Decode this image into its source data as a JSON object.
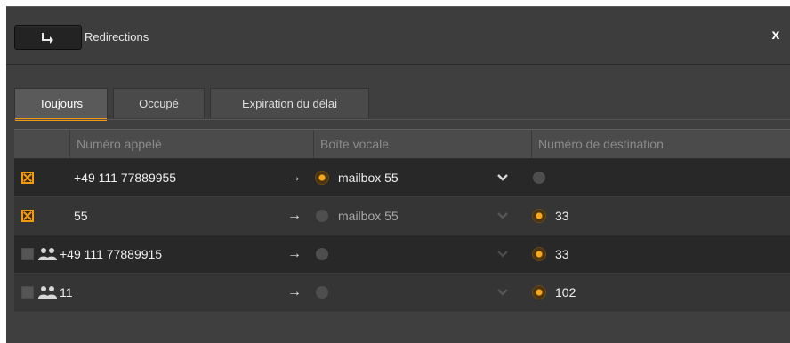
{
  "window": {
    "title": "Redirections",
    "close_label": "x"
  },
  "tabs": [
    {
      "label": "Toujours",
      "active": true
    },
    {
      "label": "Occupé",
      "active": false
    },
    {
      "label": "Expiration du délai",
      "active": false
    }
  ],
  "table": {
    "headers": [
      "Numéro appelé",
      "Boîte vocale",
      "Numéro de destination"
    ],
    "rows": [
      {
        "checked": true,
        "group": false,
        "number": "+49 111 77889955",
        "mailbox_selected": true,
        "mailbox": "mailbox 55",
        "dest_selected": false,
        "destination": ""
      },
      {
        "checked": true,
        "group": false,
        "number": "55",
        "mailbox_selected": false,
        "mailbox": "mailbox 55",
        "dest_selected": true,
        "destination": "33"
      },
      {
        "checked": false,
        "group": true,
        "number": "+49 111 77889915",
        "mailbox_selected": false,
        "mailbox": "",
        "dest_selected": true,
        "destination": "33"
      },
      {
        "checked": false,
        "group": true,
        "number": "11",
        "mailbox_selected": false,
        "mailbox": "",
        "dest_selected": true,
        "destination": "102"
      }
    ]
  },
  "icons": {
    "title_button": "redirect-arrow-icon",
    "row_arrow": "right-arrow-icon",
    "dropdown": "chevron-down-icon",
    "group": "group-users-icon"
  },
  "colors": {
    "accent": "#f29b0f",
    "background": "#3f3f3f",
    "row_dark": "#282828",
    "row_mid": "#353535"
  }
}
